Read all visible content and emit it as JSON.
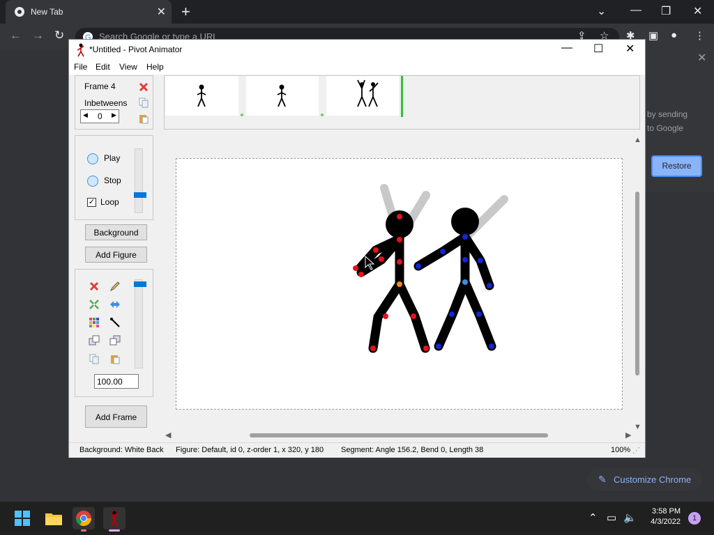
{
  "chrome": {
    "tab_title": "New Tab",
    "omnibox_placeholder": "Search Google or type a URL",
    "side_text_1": "by sending",
    "side_text_2": "to Google",
    "restore_label": "Restore",
    "customize_label": "Customize Chrome"
  },
  "pivot": {
    "window_title": "*Untitled - Pivot Animator",
    "menu": [
      "File",
      "Edit",
      "View",
      "Help"
    ],
    "frame_label": "Frame 4",
    "inbetweens_label": "Inbetweens",
    "inbetweens_value": "0",
    "play_label": "Play",
    "stop_label": "Stop",
    "loop_label": "Loop",
    "loop_checked": true,
    "background_label": "Background",
    "add_figure_label": "Add Figure",
    "zoom_value": "100.00",
    "add_frame_label": "Add Frame",
    "status": {
      "background": "Background: White Back",
      "figure": "Figure: Default,  id 0,  z-order 1,  x 320, y 180",
      "segment": "Segment: Angle 156.2,  Bend 0,  Length 38",
      "zoom": "100%"
    }
  },
  "taskbar": {
    "time": "3:58 PM",
    "date": "4/3/2022",
    "notifications": "1"
  },
  "colors": {
    "figure_joint_red": "#e8121c",
    "figure_joint_blue": "#1226d6",
    "pivot_joint_orange": "#ff8c00",
    "onion_skin": "#c8c8c8",
    "accent": "#0078d7"
  }
}
